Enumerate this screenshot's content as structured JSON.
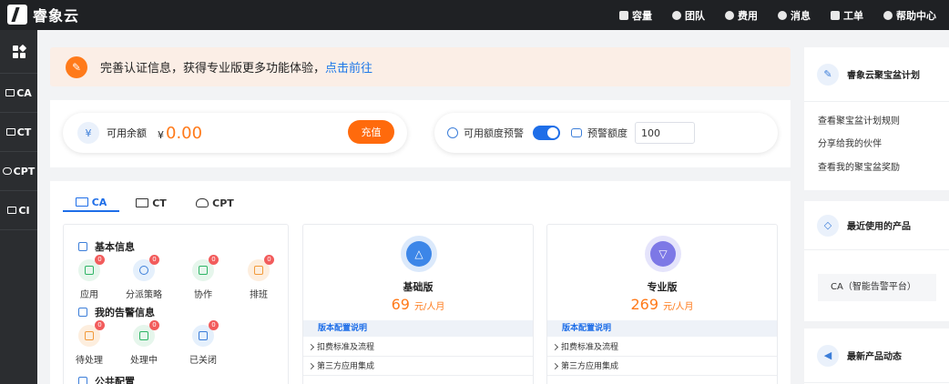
{
  "brand": {
    "name": "睿象云"
  },
  "topnav": [
    {
      "label": "容量",
      "icon": "monitor-icon"
    },
    {
      "label": "团队",
      "icon": "users-icon"
    },
    {
      "label": "费用",
      "icon": "coin-icon"
    },
    {
      "label": "消息",
      "icon": "bell-icon"
    },
    {
      "label": "工单",
      "icon": "clipboard-icon"
    },
    {
      "label": "帮助中心",
      "icon": "help-icon"
    }
  ],
  "rail": [
    {
      "label": "",
      "icon": "apps-grid-icon"
    },
    {
      "label": "CA",
      "icon": "monitor-icon"
    },
    {
      "label": "CT",
      "icon": "keyboard-icon"
    },
    {
      "label": "CPT",
      "icon": "cloud-icon"
    },
    {
      "label": "CI",
      "icon": "monitor-icon"
    }
  ],
  "banner": {
    "text": "完善认证信息，获得专业版更多功能体验，",
    "link": "点击前往"
  },
  "balance": {
    "label": "可用余额",
    "currency": "¥",
    "value": "0.00",
    "recharge": "充值"
  },
  "alert": {
    "label": "可用额度预警",
    "enabled": true,
    "threshold_label": "预警额度",
    "threshold_value": "100"
  },
  "tabs": [
    {
      "label": "CA",
      "active": true
    },
    {
      "label": "CT",
      "active": false
    },
    {
      "label": "CPT",
      "active": false
    }
  ],
  "basic_info": {
    "title": "基本信息",
    "items": [
      {
        "label": "应用",
        "badge": "0"
      },
      {
        "label": "分派策略",
        "badge": "0"
      },
      {
        "label": "协作",
        "badge": "0"
      },
      {
        "label": "排班",
        "badge": "0"
      }
    ]
  },
  "alert_info": {
    "title": "我的告警信息",
    "items": [
      {
        "label": "待处理",
        "badge": "0"
      },
      {
        "label": "处理中",
        "badge": "0"
      },
      {
        "label": "已关闭",
        "badge": "0"
      }
    ]
  },
  "public_config": {
    "title": "公共配置"
  },
  "plans": [
    {
      "name": "基础版",
      "price": "69",
      "unit": "元/人月",
      "config_title": "版本配置说明",
      "rows": [
        "扣费标准及流程",
        "第三方应用集成"
      ]
    },
    {
      "name": "专业版",
      "price": "269",
      "unit": "元/人月",
      "config_title": "版本配置说明",
      "rows": [
        "扣费标准及流程",
        "第三方应用集成"
      ]
    }
  ],
  "right_panel": {
    "plan_title": "睿象云聚宝盆计划",
    "plan_links": [
      "查看聚宝盆计划规则",
      "分享给我的伙伴",
      "查看我的聚宝盆奖励"
    ],
    "recent_title": "最近使用的产品",
    "recent_product": "CA（智能告警平台）",
    "news_title": "最新产品动态"
  },
  "colors": {
    "accent": "#1e6ee8",
    "orange": "#ff7a1a",
    "topbar": "#1f2124",
    "rail": "#2b2d30"
  }
}
